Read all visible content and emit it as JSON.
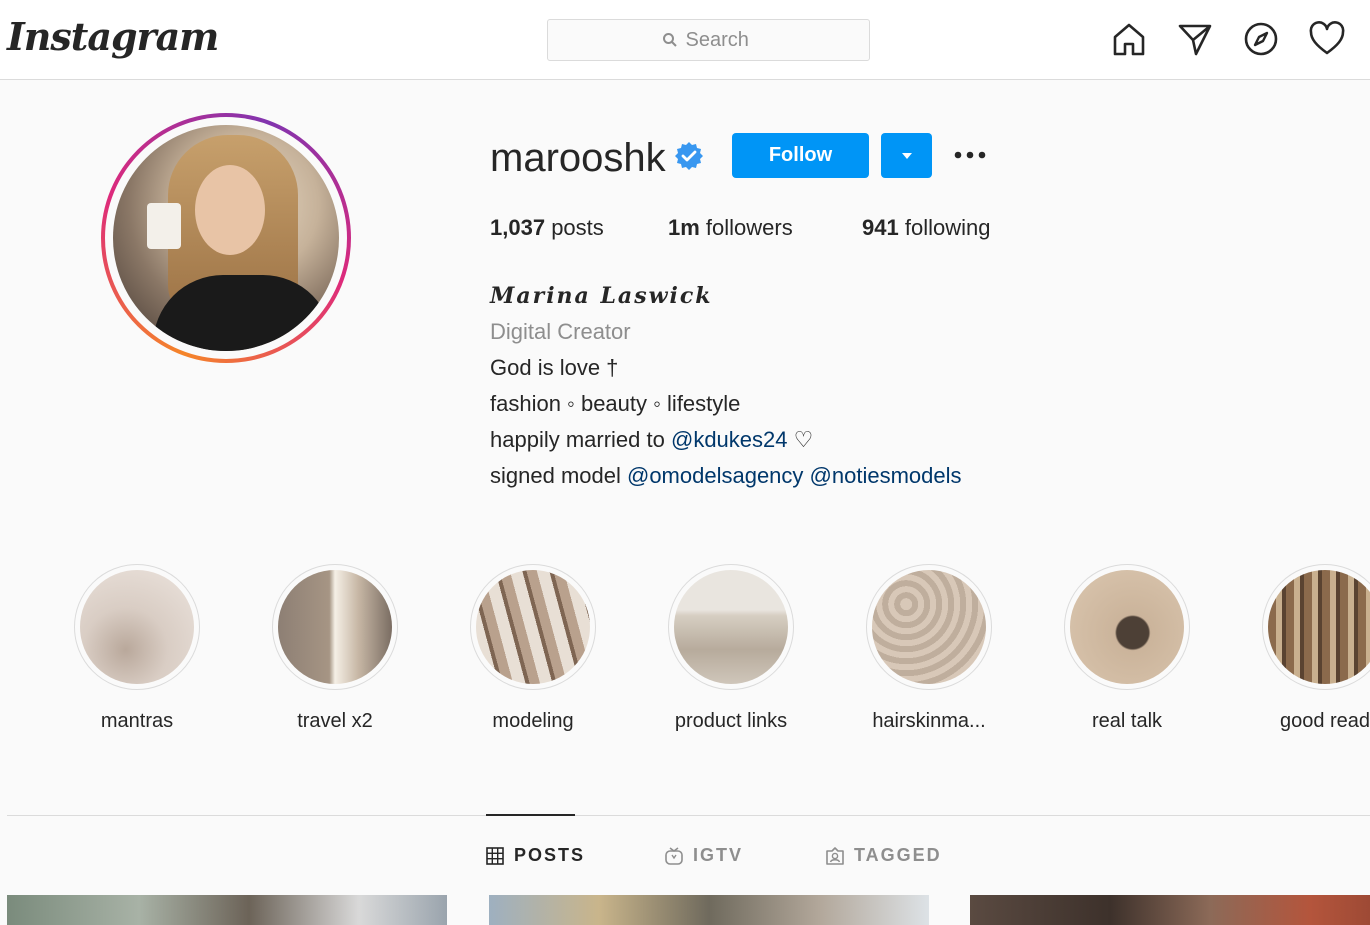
{
  "app": {
    "logo_text": "Instagram"
  },
  "search": {
    "placeholder": "Search"
  },
  "nav": {
    "icons": [
      "home-icon",
      "direct-icon",
      "explore-icon",
      "activity-icon"
    ]
  },
  "profile": {
    "username": "marooshk",
    "verified": true,
    "follow_label": "Follow",
    "stats": {
      "posts_count": "1,037",
      "posts_label": "posts",
      "followers_count": "1m",
      "followers_label": "followers",
      "following_count": "941",
      "following_label": "following"
    },
    "bio": {
      "full_name": "𝑴𝒂𝒓𝒊𝒏𝒂 𝑳𝒂𝒔𝒘𝒊𝒄𝒌",
      "category": "Digital Creator",
      "line1": "God is love †",
      "line2": "fashion ◦ beauty ◦ lifestyle",
      "line3_prefix": "happily married to ",
      "line3_link": "@kdukes24",
      "line3_suffix": " ♡",
      "line4_prefix": "signed model ",
      "line4_link1": "@omodelsagency",
      "line4_link2": "@notiesmodels"
    }
  },
  "highlights": [
    {
      "label": "mantras"
    },
    {
      "label": "travel x2"
    },
    {
      "label": "modeling"
    },
    {
      "label": "product links"
    },
    {
      "label": "hairskinma..."
    },
    {
      "label": "real talk"
    },
    {
      "label": "good read"
    }
  ],
  "tabs": [
    {
      "label": "POSTS",
      "active": true
    },
    {
      "label": "IGTV",
      "active": false
    },
    {
      "label": "TAGGED",
      "active": false
    }
  ],
  "colors": {
    "accent": "#0095f6",
    "link": "#00376b",
    "muted": "#8e8e8e"
  }
}
